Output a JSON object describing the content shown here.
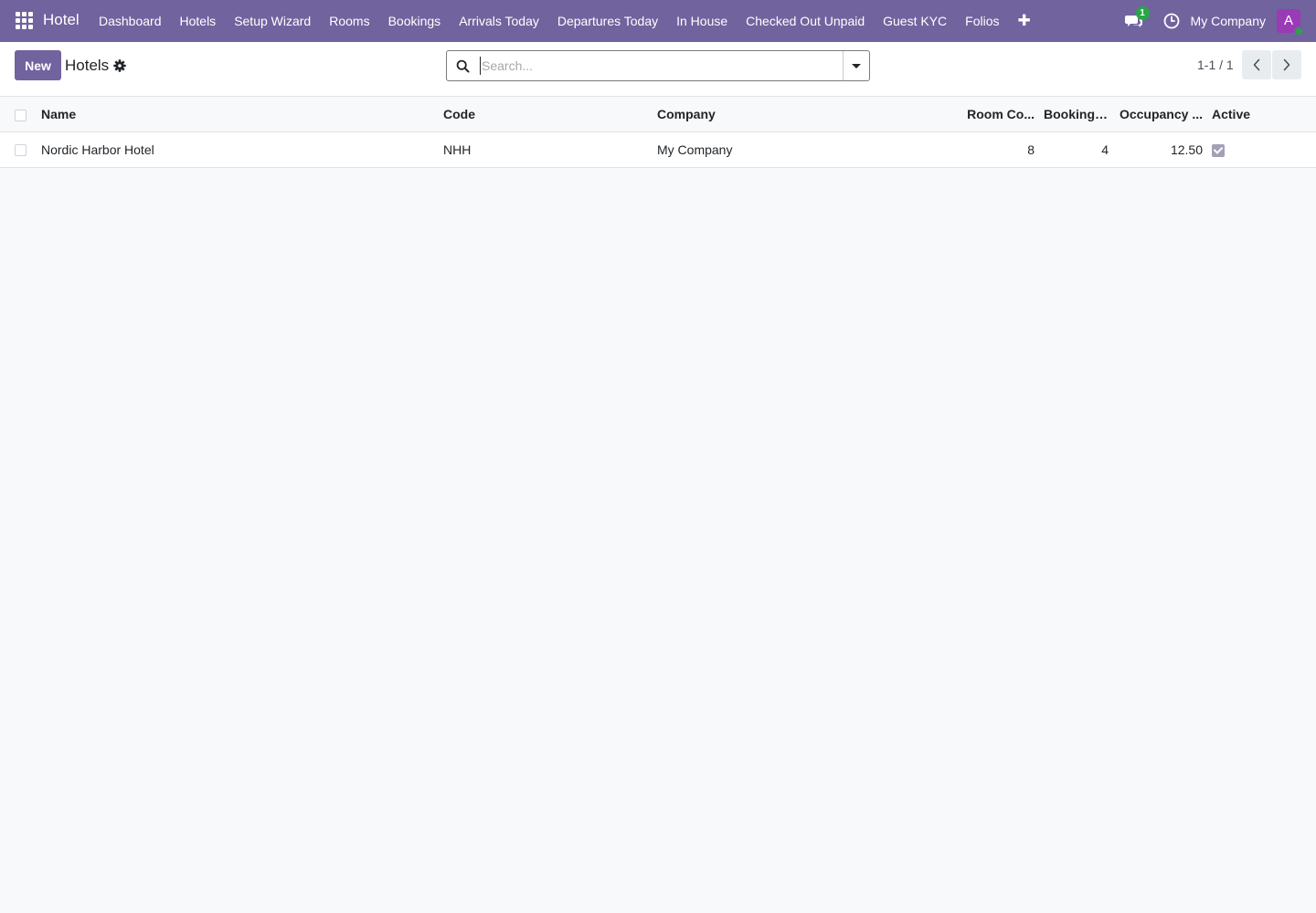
{
  "navbar": {
    "brand": "Hotel",
    "menu": [
      "Dashboard",
      "Hotels",
      "Setup Wizard",
      "Rooms",
      "Bookings",
      "Arrivals Today",
      "Departures Today",
      "In House",
      "Checked Out Unpaid",
      "Guest KYC",
      "Folios"
    ],
    "plus_label": "✚",
    "chat_badge": "1",
    "company": "My Company",
    "avatar_initial": "A"
  },
  "control_panel": {
    "new_label": "New",
    "title": "Hotels",
    "search_placeholder": "Search...",
    "pager": "1-1 / 1"
  },
  "table": {
    "columns": {
      "name": "Name",
      "code": "Code",
      "company": "Company",
      "room_count": "Room Co...",
      "booking": "Booking ...",
      "occupancy": "Occupancy ...",
      "active": "Active"
    },
    "rows": [
      {
        "name": "Nordic Harbor Hotel",
        "code": "NHH",
        "company": "My Company",
        "room_count": "8",
        "booking": "4",
        "occupancy": "12.50",
        "active": true
      }
    ]
  },
  "colors": {
    "brand": "#71639e",
    "badge": "#28a745",
    "avatar": "#9a3ab5"
  }
}
